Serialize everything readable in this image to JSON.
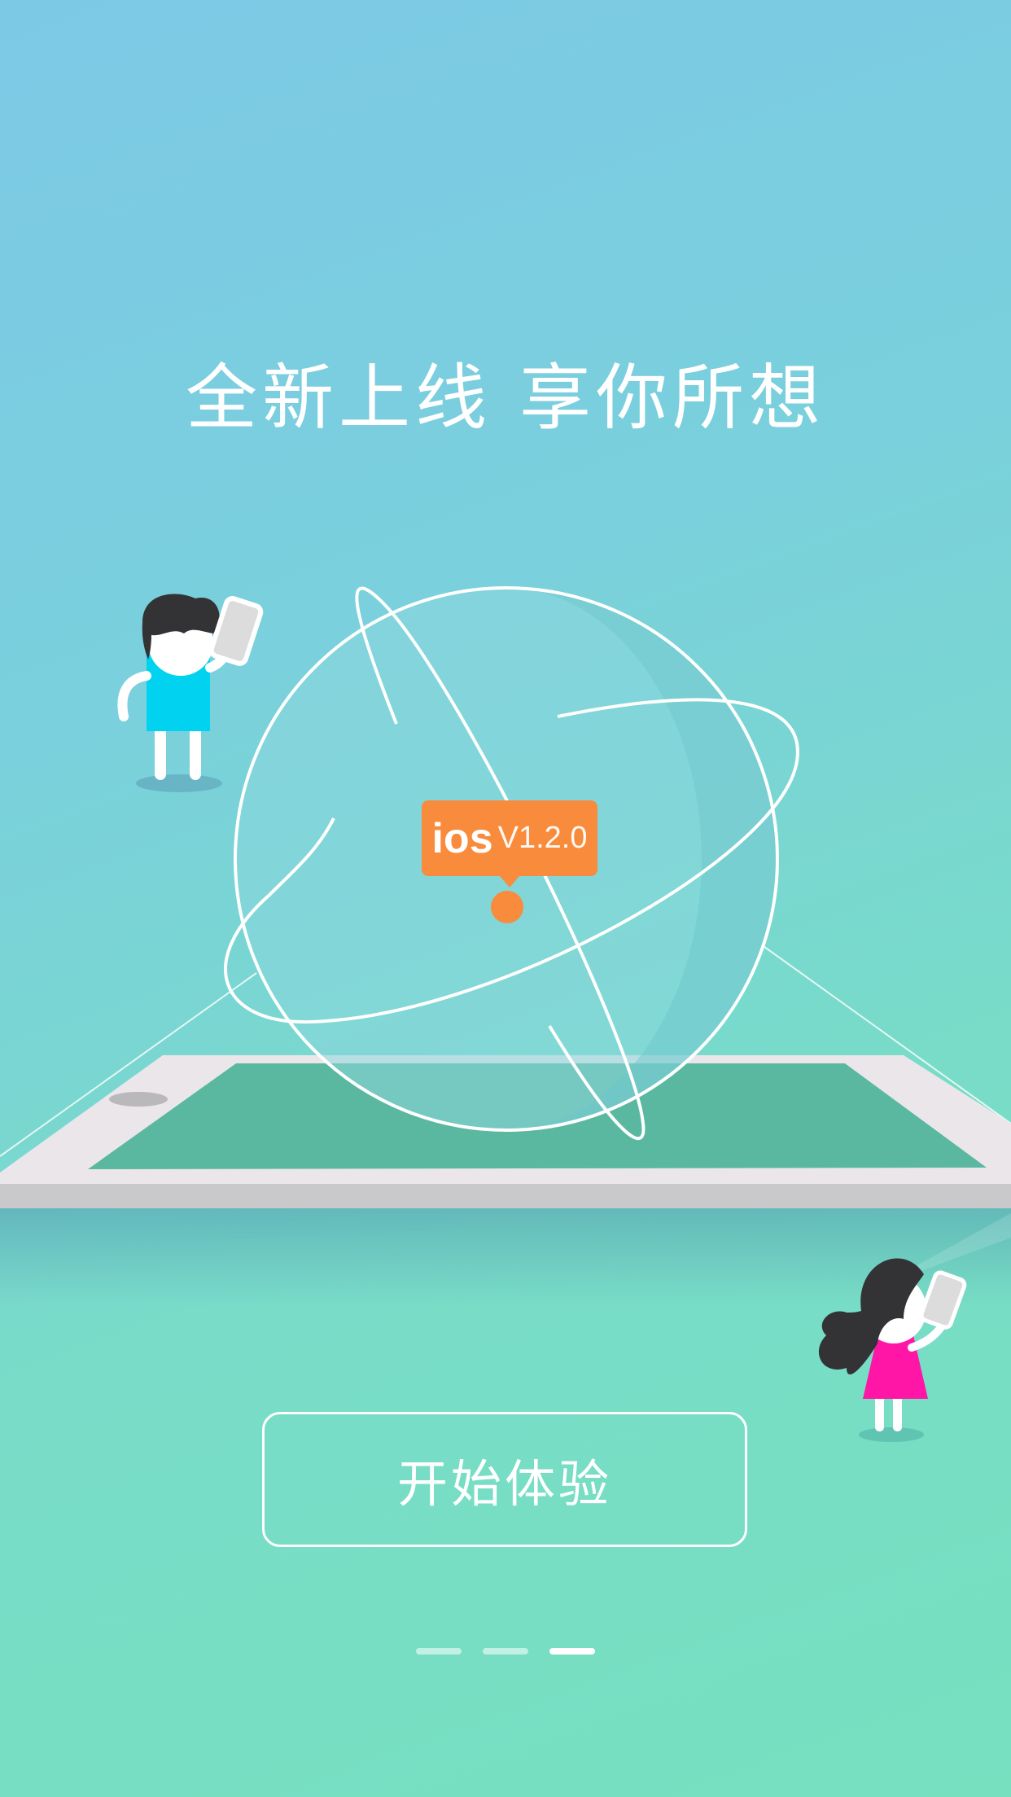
{
  "headline": "全新上线 享你所想",
  "version_badge": {
    "os": "ios",
    "version": "V1.2.0"
  },
  "start_button": {
    "label": "开始体验"
  },
  "pager": {
    "count": 3,
    "active_index": 2
  },
  "colors": {
    "accent": "#f98b3c",
    "background_top": "#7cc9e6",
    "background_bottom": "#76e0bf",
    "tablet_screen": "#5bb8a0",
    "boy_shirt": "#00d2f0",
    "girl_dress": "#ff16a6"
  },
  "icons": [
    "globe-orbit-illustration",
    "tablet-illustration",
    "boy-with-phone-illustration",
    "girl-with-phone-illustration"
  ]
}
